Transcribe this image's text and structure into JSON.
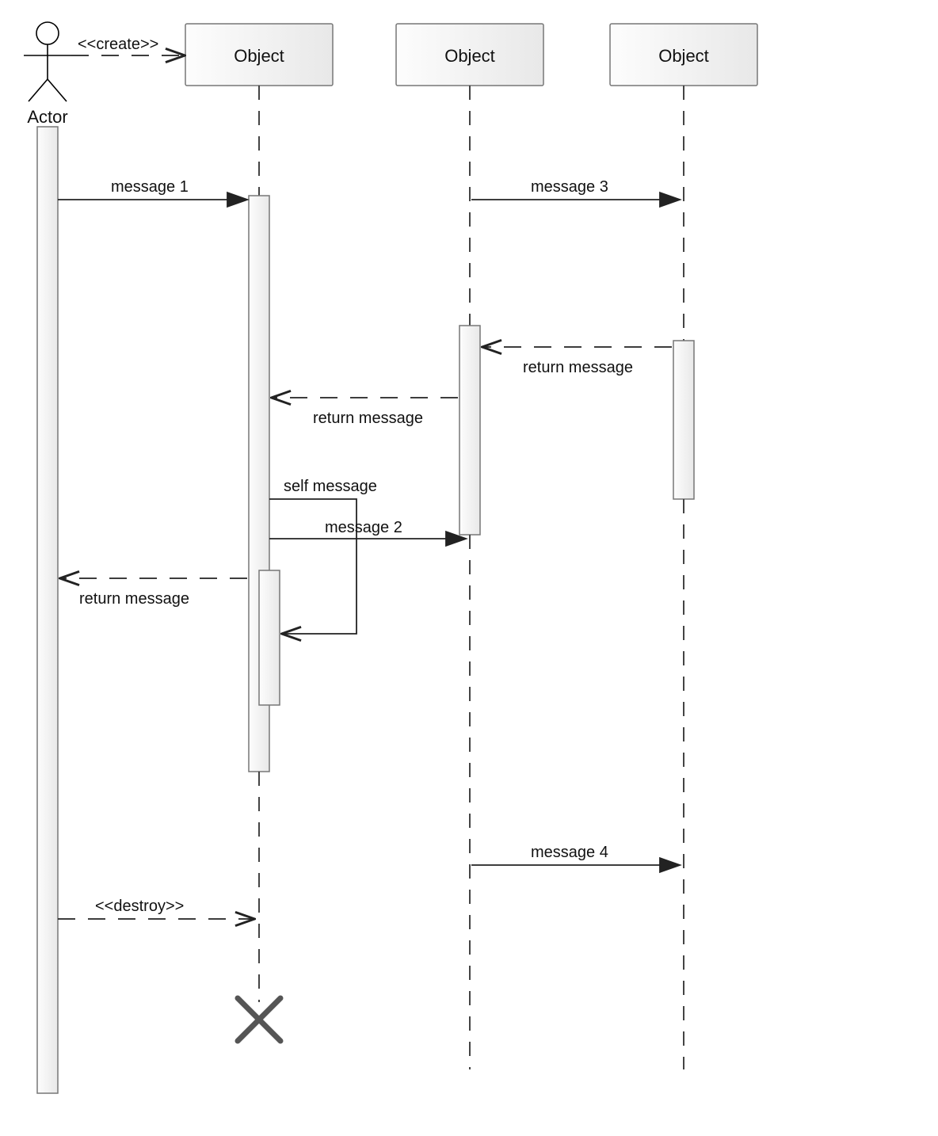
{
  "participants": {
    "actor": {
      "label": "Actor"
    },
    "obj1": {
      "label": "Object"
    },
    "obj2": {
      "label": "Object"
    },
    "obj3": {
      "label": "Object"
    }
  },
  "messages": {
    "create": "<<create>>",
    "destroy": "<<destroy>>",
    "message1": "message 1",
    "message2": "message 2",
    "message3": "message 3",
    "message4": "message 4",
    "self_message": "self message",
    "return_32": "return message",
    "return_21": "return message",
    "return_1a": "return message"
  }
}
